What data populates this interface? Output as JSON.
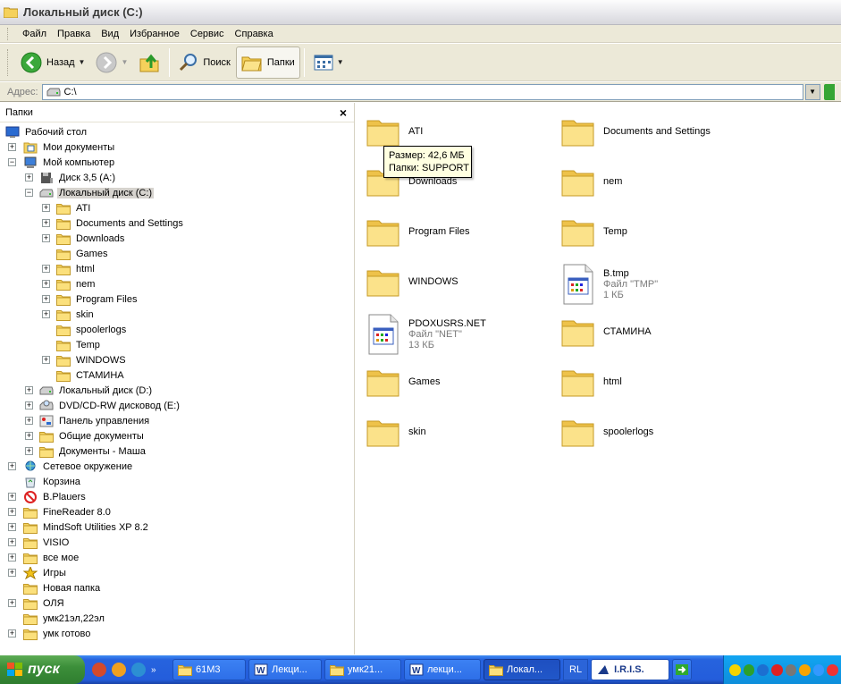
{
  "window": {
    "title": "Локальный диск (C:)"
  },
  "menu": [
    "Файл",
    "Правка",
    "Вид",
    "Избранное",
    "Сервис",
    "Справка"
  ],
  "toolbar": {
    "back": "Назад",
    "search": "Поиск",
    "folders": "Папки"
  },
  "address": {
    "label": "Адрес:",
    "value": "C:\\"
  },
  "folders_pane": {
    "title": "Папки",
    "close": "×",
    "tree": [
      {
        "label": "Рабочий стол",
        "icon": "desktop-icon"
      },
      {
        "label": "Мои документы",
        "icon": "my-documents-icon",
        "exp": "+"
      },
      {
        "label": "Мой компьютер",
        "icon": "my-computer-icon",
        "exp": "−"
      },
      {
        "label": "Диск 3,5 (A:)",
        "icon": "floppy-icon",
        "exp": "+"
      },
      {
        "label": "Локальный диск (C:)",
        "icon": "hard-drive-icon",
        "exp": "−",
        "selected": true
      },
      {
        "label": "ATI",
        "icon": "folder-icon",
        "exp": "+"
      },
      {
        "label": "Documents and Settings",
        "icon": "folder-icon",
        "exp": "+"
      },
      {
        "label": "Downloads",
        "icon": "folder-icon",
        "exp": "+"
      },
      {
        "label": "Games",
        "icon": "folder-icon"
      },
      {
        "label": "html",
        "icon": "folder-icon",
        "exp": "+"
      },
      {
        "label": "nem",
        "icon": "folder-icon",
        "exp": "+"
      },
      {
        "label": "Program Files",
        "icon": "folder-icon",
        "exp": "+"
      },
      {
        "label": "skin",
        "icon": "folder-icon",
        "exp": "+"
      },
      {
        "label": "spoolerlogs",
        "icon": "folder-icon"
      },
      {
        "label": "Temp",
        "icon": "folder-icon"
      },
      {
        "label": "WINDOWS",
        "icon": "folder-icon",
        "exp": "+"
      },
      {
        "label": "СТАМИНА",
        "icon": "folder-icon"
      },
      {
        "label": "Локальный диск (D:)",
        "icon": "hard-drive-icon",
        "exp": "+"
      },
      {
        "label": "DVD/CD-RW дисковод (E:)",
        "icon": "dvd-drive-icon",
        "exp": "+"
      },
      {
        "label": "Панель управления",
        "icon": "control-panel-icon",
        "exp": "+"
      },
      {
        "label": "Общие документы",
        "icon": "folder-icon",
        "exp": "+"
      },
      {
        "label": "Документы - Маша",
        "icon": "folder-icon",
        "exp": "+"
      },
      {
        "label": "Сетевое окружение",
        "icon": "network-icon",
        "exp": "+"
      },
      {
        "label": "Корзина",
        "icon": "recycle-bin-icon"
      },
      {
        "label": "B.Plauers",
        "icon": "no-entry-icon",
        "exp": "+"
      },
      {
        "label": "FineReader 8.0",
        "icon": "folder-icon",
        "exp": "+"
      },
      {
        "label": "MindSoft Utilities XP 8.2",
        "icon": "folder-icon",
        "exp": "+"
      },
      {
        "label": "VISIO",
        "icon": "folder-icon",
        "exp": "+"
      },
      {
        "label": "все мое",
        "icon": "folder-icon",
        "exp": "+"
      },
      {
        "label": "Игры",
        "icon": "star-icon",
        "exp": "+"
      },
      {
        "label": "Новая папка",
        "icon": "folder-icon"
      },
      {
        "label": "ОЛЯ",
        "icon": "folder-icon",
        "exp": "+"
      },
      {
        "label": "умк21эл,22эл",
        "icon": "folder-icon"
      },
      {
        "label": "умк готово",
        "icon": "folder-icon",
        "exp": "+"
      }
    ]
  },
  "files": [
    {
      "name": "ATI",
      "type": "folder"
    },
    {
      "name": "Documents and Settings",
      "type": "folder"
    },
    {
      "name": "Downloads",
      "type": "folder"
    },
    {
      "name": "nem",
      "type": "folder"
    },
    {
      "name": "Program Files",
      "type": "folder"
    },
    {
      "name": "Temp",
      "type": "folder"
    },
    {
      "name": "WINDOWS",
      "type": "folder"
    },
    {
      "name": "B.tmp",
      "type": "file",
      "line2": "Файл \"TMP\"",
      "line3": "1 КБ"
    },
    {
      "name": "PDOXUSRS.NET",
      "type": "file",
      "line2": "Файл \"NET\"",
      "line3": "13 КБ"
    },
    {
      "name": "СТАМИНА",
      "type": "folder"
    },
    {
      "name": "Games",
      "type": "folder"
    },
    {
      "name": "html",
      "type": "folder"
    },
    {
      "name": "skin",
      "type": "folder"
    },
    {
      "name": "spoolerlogs",
      "type": "folder"
    }
  ],
  "tooltip": {
    "line1": "Размер: 42,6 МБ",
    "line2": "Папки: SUPPORT"
  },
  "taskbar": {
    "start": "пуск",
    "buttons": [
      {
        "label": "61М3",
        "icon": "folder-icon"
      },
      {
        "label": "Лекци...",
        "icon": "word-icon"
      },
      {
        "label": "умк21...",
        "icon": "folder-icon"
      },
      {
        "label": "лекци...",
        "icon": "word-icon"
      },
      {
        "label": "Локал...",
        "icon": "folder-icon",
        "active": true
      }
    ],
    "lang": "RL",
    "iris": "I.R.I.S."
  },
  "colors": {
    "folder": "#f7d564",
    "taskbar": "#245ddb",
    "start": "#3c8f3a"
  }
}
